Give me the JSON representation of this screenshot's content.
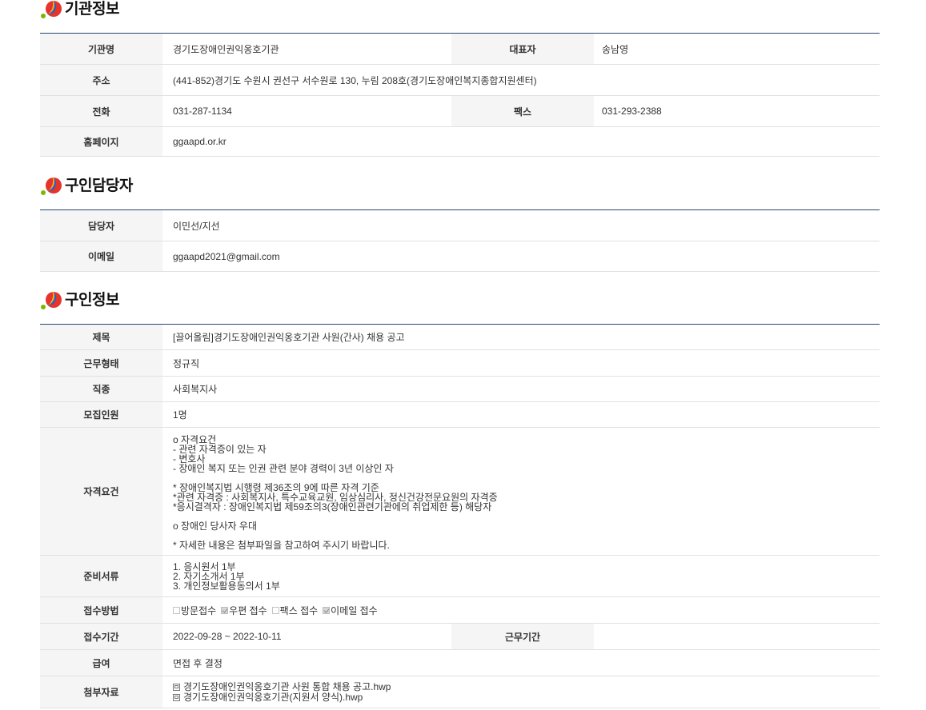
{
  "colors": {
    "table_top_border": "#2b4670",
    "label_background": "#f5f5f5",
    "row_border": "#e1e1e1"
  },
  "icons": {
    "section_bullet": "section-bullet-icon",
    "attachment": "file-icon"
  },
  "org_info": {
    "title": "기관정보",
    "org_name_label": "기관명",
    "org_name": "경기도장애인권익옹호기관",
    "ceo_label": "대표자",
    "ceo": "송남영",
    "address_label": "주소",
    "address": "(441-852)경기도 수원시 권선구 서수원로 130, 누림 208호(경기도장애인복지종합지원센터)",
    "phone_label": "전화",
    "phone": "031-287-1134",
    "fax_label": "팩스",
    "fax": "031-293-2388",
    "homepage_label": "홈페이지",
    "homepage": "ggaapd.or.kr"
  },
  "contact": {
    "title": "구인담당자",
    "manager_label": "담당자",
    "manager": "이민선/지선",
    "email_label": "이메일",
    "email": "ggaapd2021@gmail.com"
  },
  "job_info": {
    "title": "구인정보",
    "subject_label": "제목",
    "subject": "[끌어올림]경기도장애인권익옹호기관 사원(간사) 채용 공고",
    "employment_type_label": "근무형태",
    "employment_type": "정규직",
    "job_type_label": "직종",
    "job_type": "사회복지사",
    "headcount_label": "모집인원",
    "headcount": "1명",
    "qualifications_label": "자격요건",
    "qualifications": "o 자격요건\n- 관련 자격증이 있는 자\n- 변호사\n- 장애인 복지 또는 인권 관련 분야 경력이 3년 이상인 자\n\n* 장애인복지법 시행령 제36조의 9에 따른 자격 기준\n*관련 자격증 : 사회복지사, 특수교육교원, 임상심리사, 정신건강전문요원의 자격증\n*응시결격자 : 장애인복지법 제59조의3(장애인관련기관에의 취업제한 등) 해당자\n\no 장애인 당사자 우대\n\n* 자세한 내용은 첨부파일을 참고하여 주시기 바랍니다.",
    "documents_label": "준비서류",
    "documents": "1. 응시원서 1부\n2. 자기소개서 1부\n3. 개인정보활용동의서 1부",
    "apply_method_label": "접수방법",
    "apply_methods": [
      {
        "label": "방문접수",
        "checked": false
      },
      {
        "label": "우편 접수",
        "checked": true
      },
      {
        "label": "팩스 접수",
        "checked": false
      },
      {
        "label": "이메일 접수",
        "checked": true
      }
    ],
    "apply_period_label": "접수기간",
    "apply_period": "2022-09-28 ~ 2022-10-11",
    "work_period_label": "근무기간",
    "salary_label": "급여",
    "salary": "면접 후 결정",
    "attachments_label": "첨부자료",
    "attachments": [
      "경기도장애인권익옹호기관 사원 통합 채용 공고.hwp",
      "경기도장애인권익옹호기관(지원서 양식).hwp"
    ]
  }
}
